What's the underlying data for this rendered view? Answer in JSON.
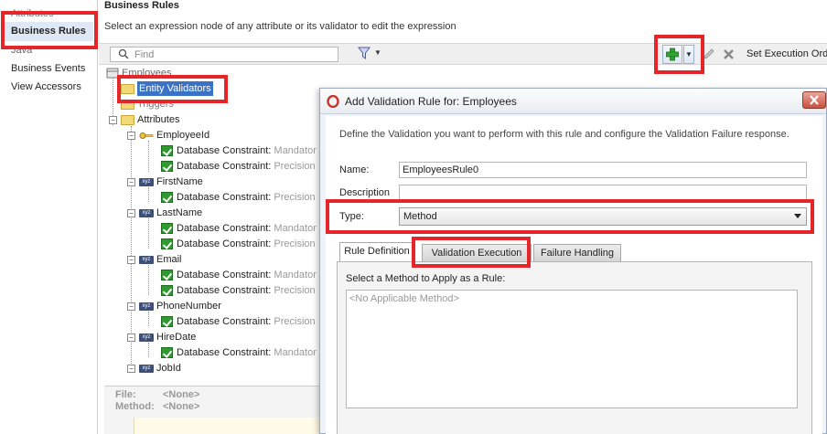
{
  "leftnav": {
    "items": [
      {
        "label": "Attributes"
      },
      {
        "label": "Business Rules"
      },
      {
        "label": "Java"
      },
      {
        "label": "Business Events"
      },
      {
        "label": "View Accessors"
      }
    ]
  },
  "main": {
    "title": "Business Rules",
    "subtitle": "Select an expression node of any attribute or its validator to edit the expression"
  },
  "toolbar": {
    "find_placeholder": "Find",
    "set_execution_label": "Set Execution Ord"
  },
  "tree": {
    "root": "Employees",
    "entity_validators": "Entity Validators",
    "triggers": "Triggers",
    "attributes": "Attributes",
    "constraint_label": "Database Constraint:",
    "attrs": [
      {
        "name": "EmployeeId",
        "rules": [
          "Mandator",
          "Precision"
        ]
      },
      {
        "name": "FirstName",
        "rules": [
          "Precision"
        ]
      },
      {
        "name": "LastName",
        "rules": [
          "Mandator",
          "Precision"
        ]
      },
      {
        "name": "Email",
        "rules": [
          "Mandator",
          "Precision"
        ]
      },
      {
        "name": "PhoneNumber",
        "rules": [
          "Precision"
        ]
      },
      {
        "name": "HireDate",
        "rules": [
          "Mandator"
        ]
      },
      {
        "name": "JobId",
        "rules": []
      }
    ]
  },
  "filepanel": {
    "file_label": "File:",
    "file_value": "<None>",
    "method_label": "Method:",
    "method_value": "<None>"
  },
  "dialog": {
    "title": "Add Validation Rule for: Employees",
    "description": "Define the Validation you want to perform with this rule and configure the Validation Failure response.",
    "name_label": "Name:",
    "name_value": "EmployeesRule0",
    "description_label": "Description",
    "description_value": "",
    "type_label": "Type:",
    "type_value": "Method",
    "tabs": [
      {
        "label": "Rule Definition"
      },
      {
        "label": "Validation Execution"
      },
      {
        "label": "Failure Handling"
      }
    ],
    "method_prompt": "Select a Method to Apply as a Rule:",
    "method_empty": "<No Applicable Method>"
  },
  "colors": {
    "annotation_red": "#e52628",
    "selection_blue": "#3a73c6"
  }
}
